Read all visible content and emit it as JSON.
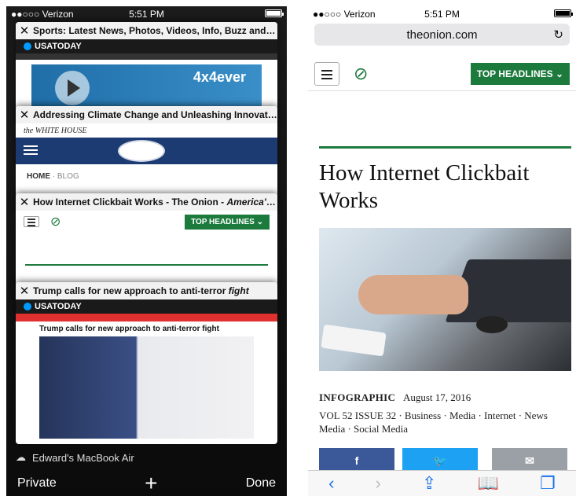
{
  "left": {
    "status": {
      "carrier": "●●○○○ Verizon",
      "time": "5:51 PM"
    },
    "tabs": [
      {
        "title": "Sports: Latest News, Photos, Videos, Info, Buzz and m..."
      },
      {
        "title": "Addressing Climate Change and Unleashing Innovation..."
      },
      {
        "title": "How Internet Clickbait Works - The Onion - ",
        "title_italic": "America's F..."
      },
      {
        "title": "Trump calls for new approach to anti-terror ",
        "title_italic": "fight"
      }
    ],
    "usatoday_logo": "USATODAY",
    "ad_text": "4x4ever",
    "whitehouse_logo": "the WHITE HOUSE",
    "crumb": {
      "home": "HOME",
      "sep": " · ",
      "blog": "BLOG"
    },
    "onion_button": "TOP HEADLINES ⌄",
    "trump_headline": "Trump calls for new approach to anti-terror fight",
    "device": "Edward's MacBook Air",
    "toolbar": {
      "private": "Private",
      "plus": "+",
      "done": "Done"
    }
  },
  "right": {
    "status": {
      "carrier": "●●○○○ Verizon",
      "time": "5:51 PM"
    },
    "url": "theonion.com",
    "reload": "↻",
    "top_headlines": "TOP HEADLINES ⌄",
    "headline": "How Internet Clickbait Works",
    "category": "INFOGRAPHIC",
    "date": "August 17, 2016",
    "tags": "VOL 52 ISSUE 32 · Business · Media · Internet · News Media · Social Media",
    "share": {
      "facebook": "f",
      "twitter": "🐦",
      "email": "✉"
    },
    "colors": {
      "onion_green": "#1d7a3d",
      "safari_blue": "#1a73e8"
    }
  }
}
